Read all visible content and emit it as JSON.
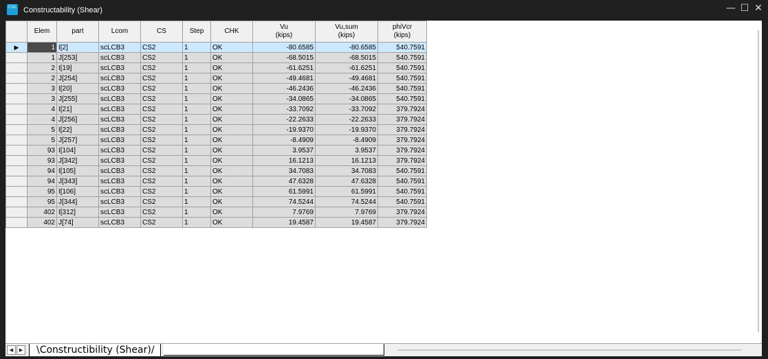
{
  "window": {
    "title": "Constructability (Shear)",
    "icon_label": "CVL",
    "controls": {
      "minimize": "—",
      "maximize": "☐",
      "close": "✕"
    }
  },
  "grid": {
    "columns": [
      {
        "key": "elem",
        "label": "Elem",
        "sub": ""
      },
      {
        "key": "part",
        "label": "part",
        "sub": ""
      },
      {
        "key": "lcom",
        "label": "Lcom",
        "sub": ""
      },
      {
        "key": "cs",
        "label": "CS",
        "sub": ""
      },
      {
        "key": "step",
        "label": "Step",
        "sub": ""
      },
      {
        "key": "chk",
        "label": "CHK",
        "sub": ""
      },
      {
        "key": "vu",
        "label": "Vu",
        "sub": "(kips)"
      },
      {
        "key": "vusum",
        "label": "Vu,sum",
        "sub": "(kips)"
      },
      {
        "key": "phivcr",
        "label": "phiVcr",
        "sub": "(kips)"
      }
    ],
    "row_indicator": "▶",
    "rows": [
      [
        "1",
        "I[2]",
        "scLCB3",
        "CS2",
        "1",
        "OK",
        "-80.6585",
        "-80.6585",
        "540.7591"
      ],
      [
        "1",
        "J[253]",
        "scLCB3",
        "CS2",
        "1",
        "OK",
        "-68.5015",
        "-68.5015",
        "540.7591"
      ],
      [
        "2",
        "I[19]",
        "scLCB3",
        "CS2",
        "1",
        "OK",
        "-61.6251",
        "-61.6251",
        "540.7591"
      ],
      [
        "2",
        "J[254]",
        "scLCB3",
        "CS2",
        "1",
        "OK",
        "-49.4681",
        "-49.4681",
        "540.7591"
      ],
      [
        "3",
        "I[20]",
        "scLCB3",
        "CS2",
        "1",
        "OK",
        "-46.2436",
        "-46.2436",
        "540.7591"
      ],
      [
        "3",
        "J[255]",
        "scLCB3",
        "CS2",
        "1",
        "OK",
        "-34.0865",
        "-34.0865",
        "540.7591"
      ],
      [
        "4",
        "I[21]",
        "scLCB3",
        "CS2",
        "1",
        "OK",
        "-33.7092",
        "-33.7092",
        "379.7924"
      ],
      [
        "4",
        "J[256]",
        "scLCB3",
        "CS2",
        "1",
        "OK",
        "-22.2633",
        "-22.2633",
        "379.7924"
      ],
      [
        "5",
        "I[22]",
        "scLCB3",
        "CS2",
        "1",
        "OK",
        "-19.9370",
        "-19.9370",
        "379.7924"
      ],
      [
        "5",
        "J[257]",
        "scLCB3",
        "CS2",
        "1",
        "OK",
        "-8.4909",
        "-8.4909",
        "379.7924"
      ],
      [
        "93",
        "I[104]",
        "scLCB3",
        "CS2",
        "1",
        "OK",
        "3.9537",
        "3.9537",
        "379.7924"
      ],
      [
        "93",
        "J[342]",
        "scLCB3",
        "CS2",
        "1",
        "OK",
        "16.1213",
        "16.1213",
        "379.7924"
      ],
      [
        "94",
        "I[105]",
        "scLCB3",
        "CS2",
        "1",
        "OK",
        "34.7083",
        "34.7083",
        "540.7591"
      ],
      [
        "94",
        "J[343]",
        "scLCB3",
        "CS2",
        "1",
        "OK",
        "47.6328",
        "47.6328",
        "540.7591"
      ],
      [
        "95",
        "I[106]",
        "scLCB3",
        "CS2",
        "1",
        "OK",
        "61.5991",
        "61.5991",
        "540.7591"
      ],
      [
        "95",
        "J[344]",
        "scLCB3",
        "CS2",
        "1",
        "OK",
        "74.5244",
        "74.5244",
        "540.7591"
      ],
      [
        "402",
        "I[312]",
        "scLCB3",
        "CS2",
        "1",
        "OK",
        "7.9769",
        "7.9769",
        "379.7924"
      ],
      [
        "402",
        "J[74]",
        "scLCB3",
        "CS2",
        "1",
        "OK",
        "19.4587",
        "19.4587",
        "379.7924"
      ]
    ]
  },
  "sheet_tabs": {
    "prev": "◀",
    "next": "▶",
    "active": "\\Constructibility (Shear)/"
  }
}
